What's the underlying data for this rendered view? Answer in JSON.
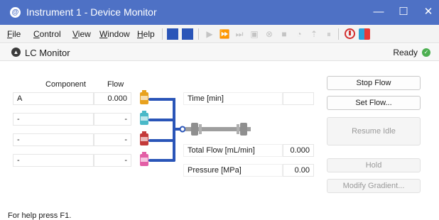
{
  "window": {
    "title": "Instrument 1 - Device Monitor",
    "minimize": "—",
    "maximize": "☐",
    "close": "✕"
  },
  "menu": {
    "file": "File",
    "control": "Control",
    "view": "View",
    "window": "Window",
    "help": "Help"
  },
  "panel": {
    "title": "LC Monitor",
    "status": "Ready",
    "status_color": "#4caf50"
  },
  "table": {
    "col_component": "Component",
    "col_flow": "Flow",
    "rows": [
      {
        "component": "A",
        "flow": "0.000",
        "bottle_color": "#e8a21f"
      },
      {
        "component": "-",
        "flow": "-",
        "bottle_color": "#4ab9c8"
      },
      {
        "component": "-",
        "flow": "-",
        "bottle_color": "#c43a3a"
      },
      {
        "component": "-",
        "flow": "-",
        "bottle_color": "#e35fa6"
      }
    ]
  },
  "readouts": {
    "time_label": "Time [min]",
    "time_value": "",
    "total_flow_label": "Total Flow [mL/min]",
    "total_flow_value": "0.000",
    "pressure_label": "Pressure [MPa]",
    "pressure_value": "0.00"
  },
  "buttons": {
    "stop_flow": "Stop Flow",
    "set_flow": "Set Flow...",
    "resume_idle": "Resume Idle",
    "hold": "Hold",
    "modify_gradient": "Modify Gradient..."
  },
  "statusbar": {
    "text": "For help press F1."
  },
  "colors": {
    "titlebar": "#4e71c5",
    "pipe": "#2a55b8"
  }
}
